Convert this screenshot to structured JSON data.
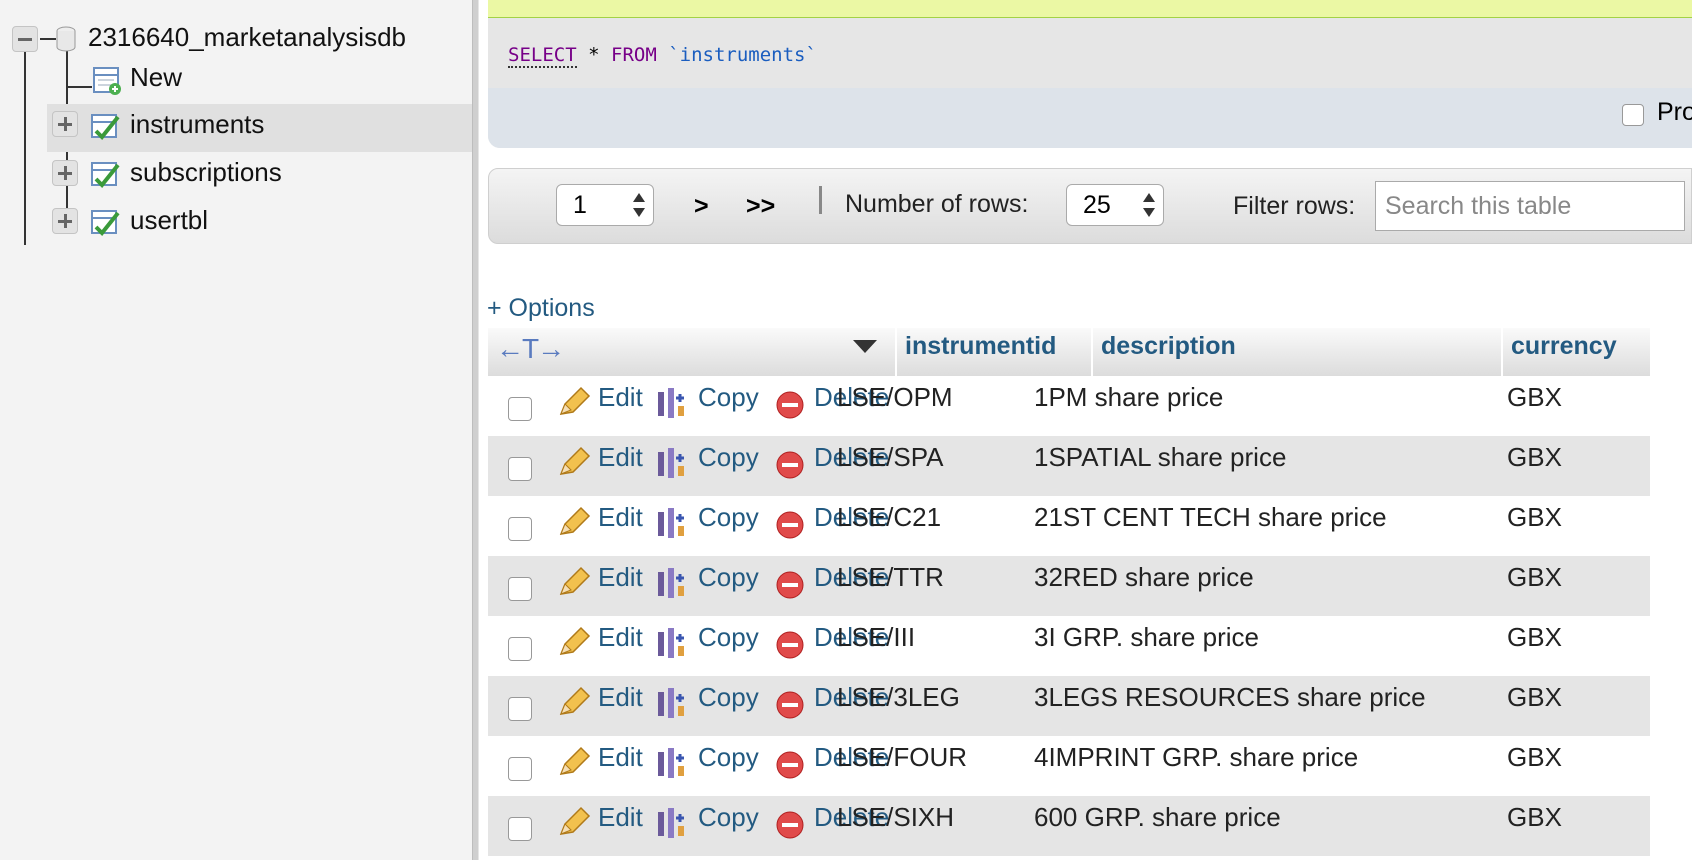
{
  "nav": {
    "database": "2316640_marketanalysisdb",
    "new_label": "New",
    "tables": [
      "instruments",
      "subscriptions",
      "usertbl"
    ]
  },
  "sql": {
    "keyword_select": "SELECT",
    "star": "*",
    "keyword_from": "FROM",
    "table_ref": "`instruments`",
    "profiling_label": "Pro"
  },
  "pager": {
    "page": "1",
    "next": ">",
    "last": ">>",
    "rows_label": "Number of rows:",
    "rows_value": "25",
    "filter_label": "Filter rows:",
    "filter_placeholder": "Search this table"
  },
  "options_label": "+ Options",
  "table": {
    "columns": [
      "instrumentid",
      "description",
      "currency"
    ],
    "actions": {
      "edit": "Edit",
      "copy": "Copy",
      "delete": "Delete"
    },
    "rows": [
      {
        "instrumentid": "LSE/OPM",
        "description": "1PM share price",
        "currency": "GBX"
      },
      {
        "instrumentid": "LSE/SPA",
        "description": "1SPATIAL share price",
        "currency": "GBX"
      },
      {
        "instrumentid": "LSE/C21",
        "description": "21ST CENT TECH share price",
        "currency": "GBX"
      },
      {
        "instrumentid": "LSE/TTR",
        "description": "32RED share price",
        "currency": "GBX"
      },
      {
        "instrumentid": "LSE/III",
        "description": "3I GRP. share price",
        "currency": "GBX"
      },
      {
        "instrumentid": "LSE/3LEG",
        "description": "3LEGS RESOURCES share price",
        "currency": "GBX"
      },
      {
        "instrumentid": "LSE/FOUR",
        "description": "4IMPRINT GRP. share price",
        "currency": "GBX"
      },
      {
        "instrumentid": "LSE/SIXH",
        "description": "600 GRP. share price",
        "currency": "GBX"
      }
    ]
  },
  "colors": {
    "link": "#235a81",
    "sql_keyword": "#770088",
    "sql_string": "#1a5dbf",
    "success_bar": "#ebf8a4"
  }
}
